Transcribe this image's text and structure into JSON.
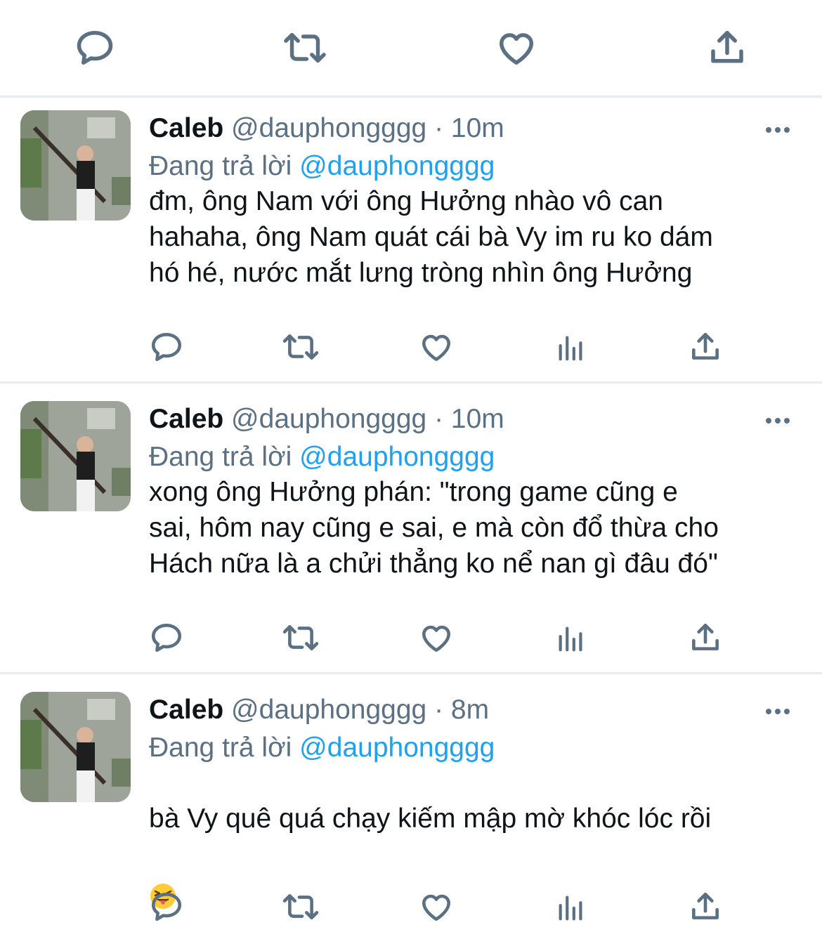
{
  "colors": {
    "text": "#0f1419",
    "secondary": "#5b7083",
    "accent": "#1da1f2",
    "divider": "#e6ecf0"
  },
  "top_actions": [
    "reply-icon",
    "retweet-icon",
    "like-icon",
    "share-icon"
  ],
  "tweet_actions": [
    "reply-icon",
    "retweet-icon",
    "like-icon",
    "analytics-icon",
    "share-icon"
  ],
  "tweets": [
    {
      "name": "Caleb",
      "handle": "@dauphongggg",
      "separator": "·",
      "time": "10m",
      "replying_prefix": "Đang trả lời",
      "replying_to": "@dauphongggg",
      "text": "đm, ông Nam với ông Hưởng nhào vô can\nhahaha, ông Nam quát cái bà Vy im ru ko dám\nhó hé, nước mắt lưng tròng nhìn ông Hưởng"
    },
    {
      "name": "Caleb",
      "handle": "@dauphongggg",
      "separator": "·",
      "time": "10m",
      "replying_prefix": "Đang trả lời",
      "replying_to": "@dauphongggg",
      "text": "xong ông Hưởng phán: \"trong game cũng e\nsai, hôm nay cũng e sai, e mà còn đổ thừa cho\nHách nữa là a chửi thẳng ko nể nan gì đâu đó\""
    },
    {
      "name": "Caleb",
      "handle": "@dauphongggg",
      "separator": "·",
      "time": "8m",
      "replying_prefix": "Đang trả lời",
      "replying_to": "@dauphongggg",
      "text": "bà Vy quê quá chạy kiếm mập mờ khóc lóc rồi",
      "emoji": "squinting-face-with-tongue"
    }
  ]
}
